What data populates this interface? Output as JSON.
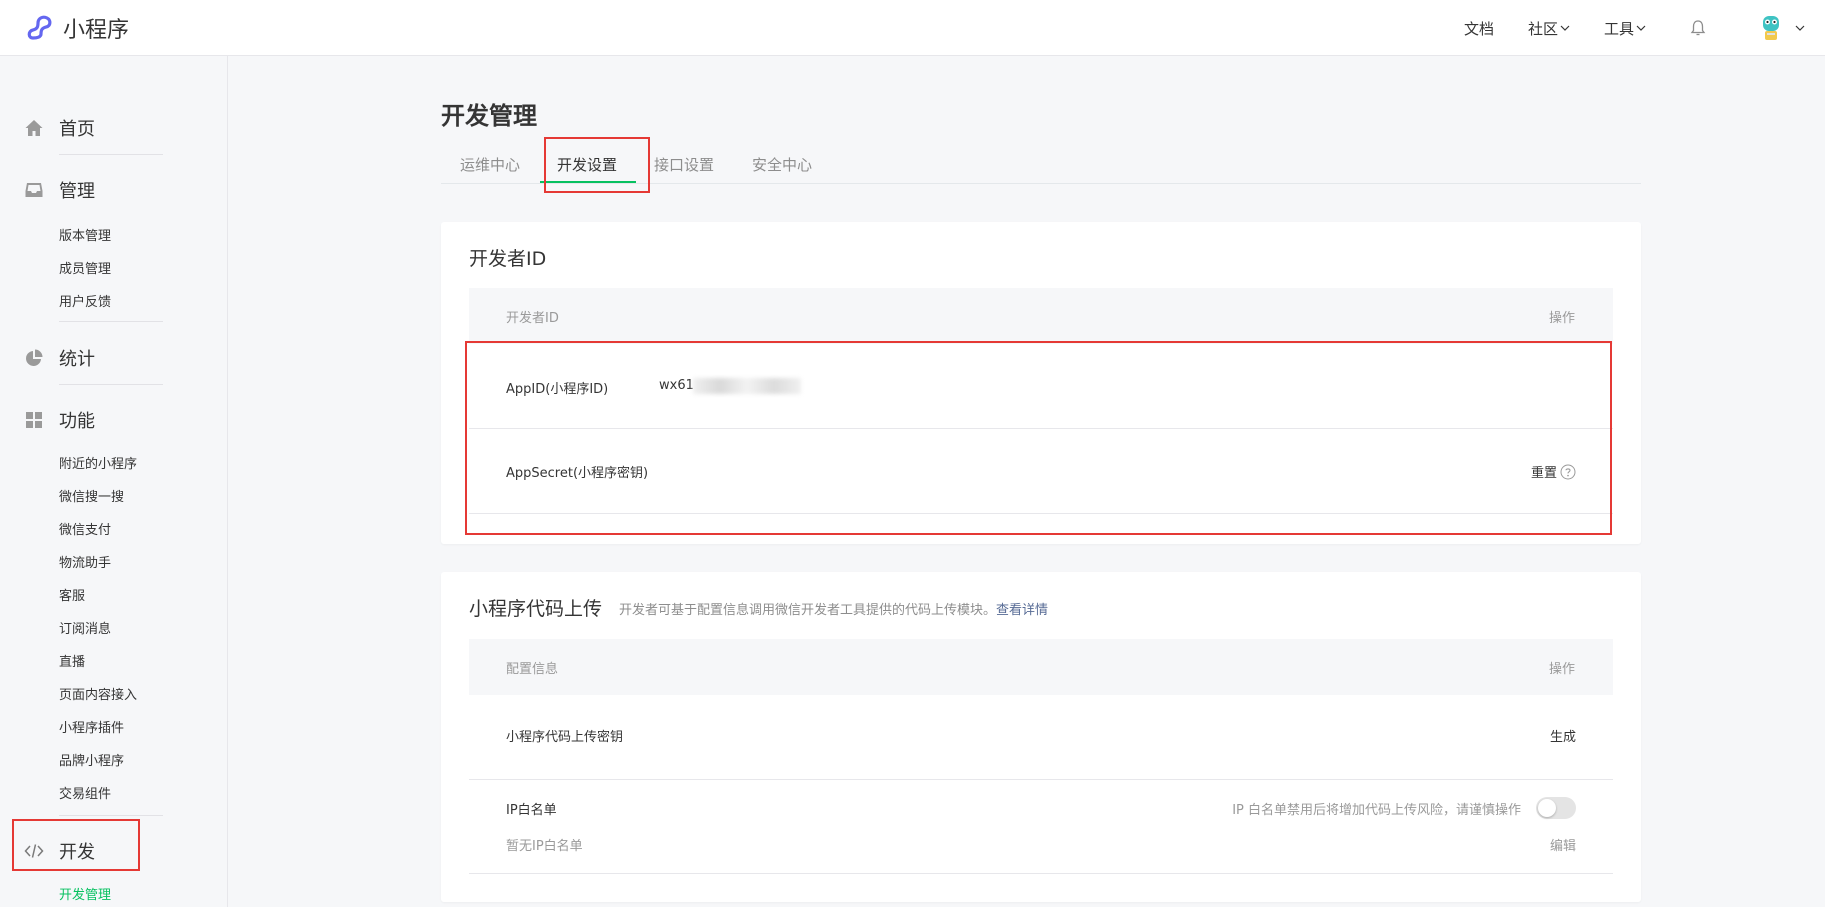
{
  "header": {
    "app_name": "小程序",
    "nav": [
      {
        "label": "文档"
      },
      {
        "label": "社区"
      },
      {
        "label": "工具"
      }
    ]
  },
  "sidebar": {
    "home": "首页",
    "manage": {
      "label": "管理",
      "items": [
        "版本管理",
        "成员管理",
        "用户反馈"
      ]
    },
    "stats": "统计",
    "features": {
      "label": "功能",
      "items": [
        "附近的小程序",
        "微信搜一搜",
        "微信支付",
        "物流助手",
        "客服",
        "订阅消息",
        "直播",
        "页面内容接入",
        "小程序插件",
        "品牌小程序",
        "交易组件"
      ]
    },
    "dev": {
      "label": "开发",
      "items": [
        "开发管理"
      ],
      "active_item": "开发管理"
    }
  },
  "main": {
    "title": "开发管理",
    "tabs": [
      "运维中心",
      "开发设置",
      "接口设置",
      "安全中心"
    ],
    "active_tab": "开发设置",
    "developer_id_card": {
      "title": "开发者ID",
      "columns": [
        "开发者ID",
        "操作"
      ],
      "rows": [
        {
          "label": "AppID(小程序ID)",
          "value": "wx61"
        },
        {
          "label": "AppSecret(小程序密钥)",
          "action": "重置"
        }
      ]
    },
    "upload_card": {
      "title": "小程序代码上传",
      "description": "开发者可基于配置信息调用微信开发者工具提供的代码上传模块。",
      "detail_link": "查看详情",
      "columns": [
        "配置信息",
        "操作"
      ],
      "rows": [
        {
          "label": "小程序代码上传密钥",
          "action": "生成"
        },
        {
          "label": "IP白名单",
          "sublabel": "暂无IP白名单",
          "warning": "IP 白名单禁用后将增加代码上传风险，请谨慎操作",
          "action": "编辑",
          "toggle_on": false
        }
      ]
    }
  },
  "colors": {
    "accent_green": "#07c160",
    "link_blue": "#576b95",
    "highlight_red": "#e53935",
    "logo_purple": "#6467f0"
  }
}
